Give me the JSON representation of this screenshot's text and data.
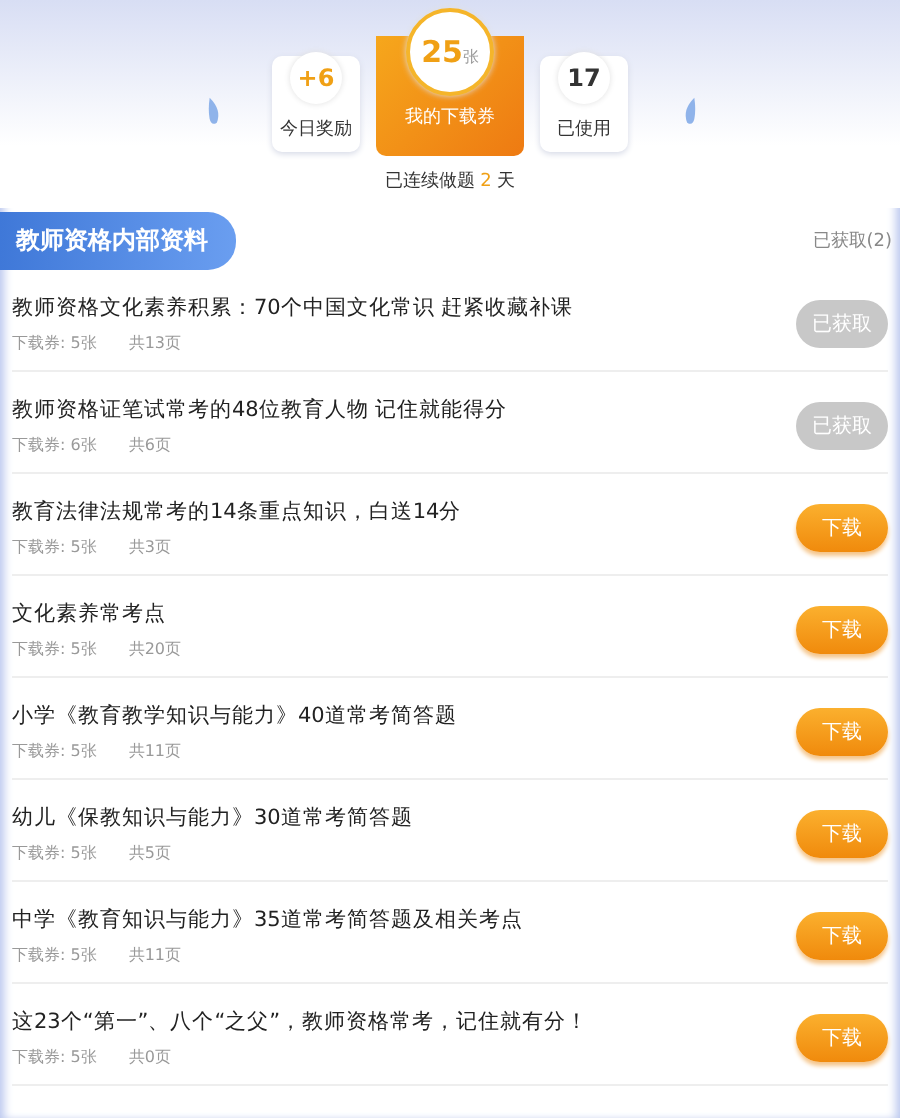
{
  "stats": [
    {
      "kind": "reward",
      "value": "+6",
      "label": "今日奖励"
    },
    {
      "kind": "main",
      "value": "25",
      "unit": "张",
      "label": "我的下载券"
    },
    {
      "kind": "used",
      "value": "17",
      "label": "已使用"
    }
  ],
  "streak": {
    "prefix": "已连续做题",
    "count": "2",
    "suffix": "天"
  },
  "section": {
    "title": "教师资格内部资料",
    "obtained_count": "已获取(2)"
  },
  "items": [
    {
      "title": "教师资格文化素养积累：70个中国文化常识 赶紧收藏补课",
      "tickets": "下载券: 5张",
      "pages": "共13页",
      "obtained": true,
      "button": "已获取"
    },
    {
      "title": "教师资格证笔试常考的48位教育人物 记住就能得分",
      "tickets": "下载券: 6张",
      "pages": "共6页",
      "obtained": true,
      "button": "已获取"
    },
    {
      "title": "教育法律法规常考的14条重点知识，白送14分",
      "tickets": "下载券: 5张",
      "pages": "共3页",
      "obtained": false,
      "button": "下载"
    },
    {
      "title": "文化素养常考点",
      "tickets": "下载券: 5张",
      "pages": "共20页",
      "obtained": false,
      "button": "下载"
    },
    {
      "title": "小学《教育教学知识与能力》40道常考简答题",
      "tickets": "下载券: 5张",
      "pages": "共11页",
      "obtained": false,
      "button": "下载"
    },
    {
      "title": "幼儿《保教知识与能力》30道常考简答题",
      "tickets": "下载券: 5张",
      "pages": "共5页",
      "obtained": false,
      "button": "下载"
    },
    {
      "title": "中学《教育知识与能力》35道常考简答题及相关考点",
      "tickets": "下载券: 5张",
      "pages": "共11页",
      "obtained": false,
      "button": "下载"
    },
    {
      "title": "这23个“第一”、八个“之父”，教师资格常考，记住就有分！",
      "tickets": "下载券: 5张",
      "pages": "共0页",
      "obtained": false,
      "button": "下载"
    }
  ]
}
